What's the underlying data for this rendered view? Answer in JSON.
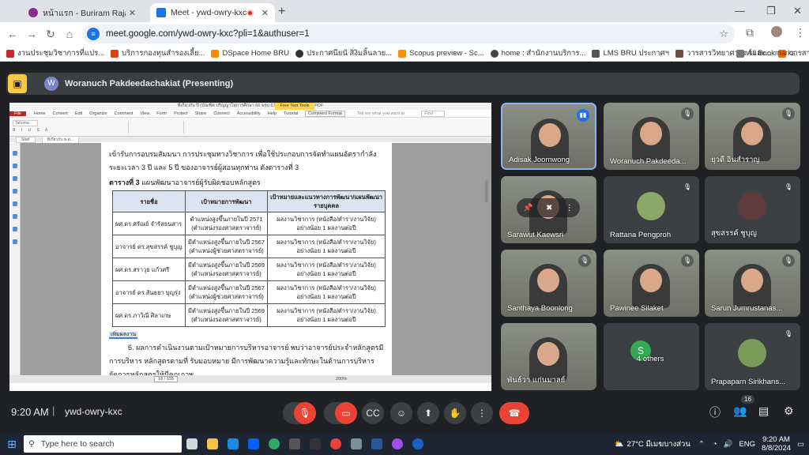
{
  "browser": {
    "tabs": [
      {
        "title": "หน้าแรก - Buriram Rajabhat Univ",
        "favicon_color": "#8e2a8e"
      },
      {
        "title": "Meet - ywd-owry-kxc",
        "favicon_color": "#1a73e8"
      }
    ],
    "url": "meet.google.com/ywd-owry-kxc?pli=1&authuser=1",
    "bookmarks": [
      {
        "label": "งานประชุมวิชาการที่แปร...",
        "color": "#c62828"
      },
      {
        "label": "บริการกองทุนสำรองเลี้ย...",
        "color": "#d84315"
      },
      {
        "label": "DSpace Home BRU",
        "color": "#fb8c00"
      },
      {
        "label": "ประกาศนียนั สิ่งิมลิ้นลาย...",
        "color": "#333333"
      },
      {
        "label": "Scopus preview - Sc...",
        "color": "#ff8f00"
      },
      {
        "label": "home : สำนักงานบริการ...",
        "color": "#444444"
      },
      {
        "label": "LMS BRU ประกาศฯ",
        "color": "#555555"
      },
      {
        "label": "วารสารวิทยาศาสตร์และ...",
        "color": "#6d4c41"
      },
      {
        "label": "วารสารวิจัย มหาวิทยาลั...",
        "color": "#ef6c00"
      }
    ],
    "all_bookmarks": "All Bookmarks"
  },
  "meet": {
    "presenter_initial": "W",
    "presenter": "Woranuch Pakdeedachakiat (Presenting)",
    "time": "9:20 AM",
    "code": "ywd-owry-kxc",
    "participants_count": "16",
    "participants": [
      {
        "name": "Adisak Joomwong",
        "type": "video",
        "status": "speaking"
      },
      {
        "name": "Woranuch Pakdeeda...",
        "type": "video",
        "status": "muted"
      },
      {
        "name": "ยุวดี อินสำราญ",
        "type": "video",
        "status": "muted"
      },
      {
        "name": "Sarawut Kaewsri",
        "type": "video",
        "status": "pinned"
      },
      {
        "name": "Rattana Pengproh",
        "type": "avatar",
        "status": "muted",
        "avatar_color": "#8aa86a"
      },
      {
        "name": "สุขสรรค์ ชูบุญ",
        "type": "avatar",
        "status": "muted",
        "avatar_color": "#5f3b3b"
      },
      {
        "name": "Santhaya Boonlong",
        "type": "video",
        "status": "muted"
      },
      {
        "name": "Pawinee Silaket",
        "type": "video",
        "status": "muted"
      },
      {
        "name": "Sarun Jumrustanas...",
        "type": "video",
        "status": "muted"
      },
      {
        "name": "พันธ์วา แก่นมาลย์",
        "type": "video",
        "status": "none"
      },
      {
        "name": "4 others",
        "type": "others",
        "status": "none",
        "avatar_color": "#34a853",
        "initial": "S"
      },
      {
        "name": "Prapaparn Sirikhans...",
        "type": "avatar",
        "status": "muted",
        "avatar_color": "#7a9a5a"
      }
    ]
  },
  "document": {
    "window_title": "ที่เกี่ยวกับ ปี (บัณฑิต ปริญญาโทการศึกษา 66 พรบ 67.pdf - Foxit PhantomPDF",
    "context_tab": "Free Text Tools",
    "menu": [
      "File",
      "Home",
      "Convert",
      "Edit",
      "Organize",
      "Comment",
      "View",
      "Form",
      "Protect",
      "Share",
      "Connect",
      "Accessibility",
      "Help",
      "Tutorial",
      "Comment Format"
    ],
    "tell_me": "Tell me what you want to",
    "find": "Find",
    "font": "Tahoma",
    "doc_tabs": [
      "Start",
      "ที่เกี่ยวกับ พ.ศ..."
    ],
    "para1": "เข้ารับการอบรมสัมมนา การประชุมทางวิชาการ เพื่อใช้ประกอบการจัดทำแผนอัตรากำลังระยะเวลา 3 ปี และ 5 ปี ของอาจารย์ผู้สอนทุกท่าน ดังตารางที่ 3",
    "table_caption_bold": "ตารางที่ 3",
    "table_caption": " แผนพัฒนาอาจารย์ผู้รับผิดชอบหลักสูตร",
    "table_headers": [
      "รายชื่อ",
      "เป้าหมายการพัฒนา",
      "เป้าหมายและแนวทางการพัฒนา/แผนพัฒนารายบุคคล"
    ],
    "table_rows": [
      [
        "ผศ.ดร.ศรัณย์ จำรัสธนสาร",
        "ตำแหน่งสูงขึ้นภายในปี 2571 (ตำแหน่งรองศาสตราจารย์)",
        "ผลงานวิชาการ (หนังสือ/ตำรา/งานวิจัย) อย่างน้อย 1 ผลงานต่อปี"
      ],
      [
        "อาจารย์ ดร.สุขสรรค์ ชูบุญ",
        "มีตำแหน่งสูงขึ้นภายในปี 2567 (ตำแหน่งผู้ช่วยศาสตราจารย์)",
        "ผลงานวิชาการ (หนังสือ/ตำรา/งานวิจัย) อย่างน้อย 1 ผลงานต่อปี"
      ],
      [
        "ผศ.ดร.สราวุธ แก้วศรี",
        "มีตำแหน่งสูงขึ้นภายในปี 2569 (ตำแหน่งรองศาสตราจารย์)",
        "ผลงานวิชาการ (หนังสือ/ตำรา/งานวิจัย) อย่างน้อย 1 ผลงานต่อปี"
      ],
      [
        "อาจารย์ ดร.สันธยา บุญรุ่ง",
        "มีตำแหน่งสูงขึ้นภายในปี 2567 (ตำแหน่งผู้ช่วยศาสตราจารย์)",
        "ผลงานวิชาการ (หนังสือ/ตำรา/งานวิจัย) อย่างน้อย 1 ผลงานต่อปี"
      ],
      [
        "ผศ.ดร.ภาวิณี ศิลาเกษ",
        "มีตำแหน่งสูงขึ้นภายในปี 2569 (ตำแหน่งรองศาสตราจารย์)",
        "ผลงานวิชาการ (หนังสือ/ตำรา/งานวิจัย) อย่างน้อย 1 ผลงานต่อปี"
      ]
    ],
    "annotation": "เพิ่มผลงาน",
    "para2": "6. ผลการดำเนินงานตามเป้าหมายการบริหารอาจารย์ พบว่าอาจารย์ประจำหลักสูตรมีการบริหาร หลักสูตรตามที่ รับมอบหมาย มีการพัฒนาความรู้และทักษะในด้านการบริหารจัดการหลักสูตรให้มีคุณภาพ",
    "page_indicator": "18 / 135",
    "zoom": "200%"
  },
  "taskbar": {
    "search_placeholder": "Type here to search",
    "weather": "27°C มีเมฆบางส่วน",
    "lang": "ENG",
    "time": "9:20 AM",
    "date": "8/8/2024"
  }
}
